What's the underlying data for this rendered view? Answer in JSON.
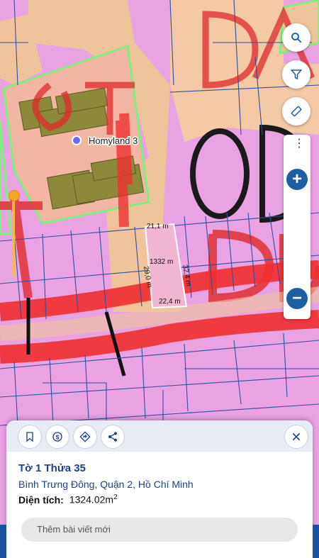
{
  "map": {
    "poi_label": "Homyland 3",
    "measurements": {
      "top_edge": "21,1 m",
      "left_edge": "29,0 m",
      "right_edge": "32,4 m",
      "bottom_edge": "22,4 m",
      "area": "1332 m"
    },
    "zone_letters": [
      "DA",
      "OT",
      "OD",
      "ODT",
      "OD"
    ]
  },
  "controls": {
    "search_icon": "search-icon",
    "filter_icon": "filter-icon",
    "ruler_icon": "ruler-icon",
    "more_icon": "more-vertical-icon",
    "zoom_in": "+",
    "zoom_out": "−",
    "zoom_level": 0.0
  },
  "sheet": {
    "title": "Tờ 1 Thửa 35",
    "address": "Bình Trưng Đông, Quận 2, Hồ Chí Minh",
    "area_label": "Diện tích:",
    "area_value": "1324.02m",
    "area_unit_sup": "2",
    "new_post_placeholder": "Thêm bài viết mới"
  },
  "colors": {
    "residential_pink": "#e9a3e3",
    "road_tan": "#f0c49a",
    "road_red": "#ef2f2f",
    "boundary_blue": "#2f4fa0",
    "primary_blue": "#1d5fa3",
    "accent_orange": "#f5a623"
  }
}
